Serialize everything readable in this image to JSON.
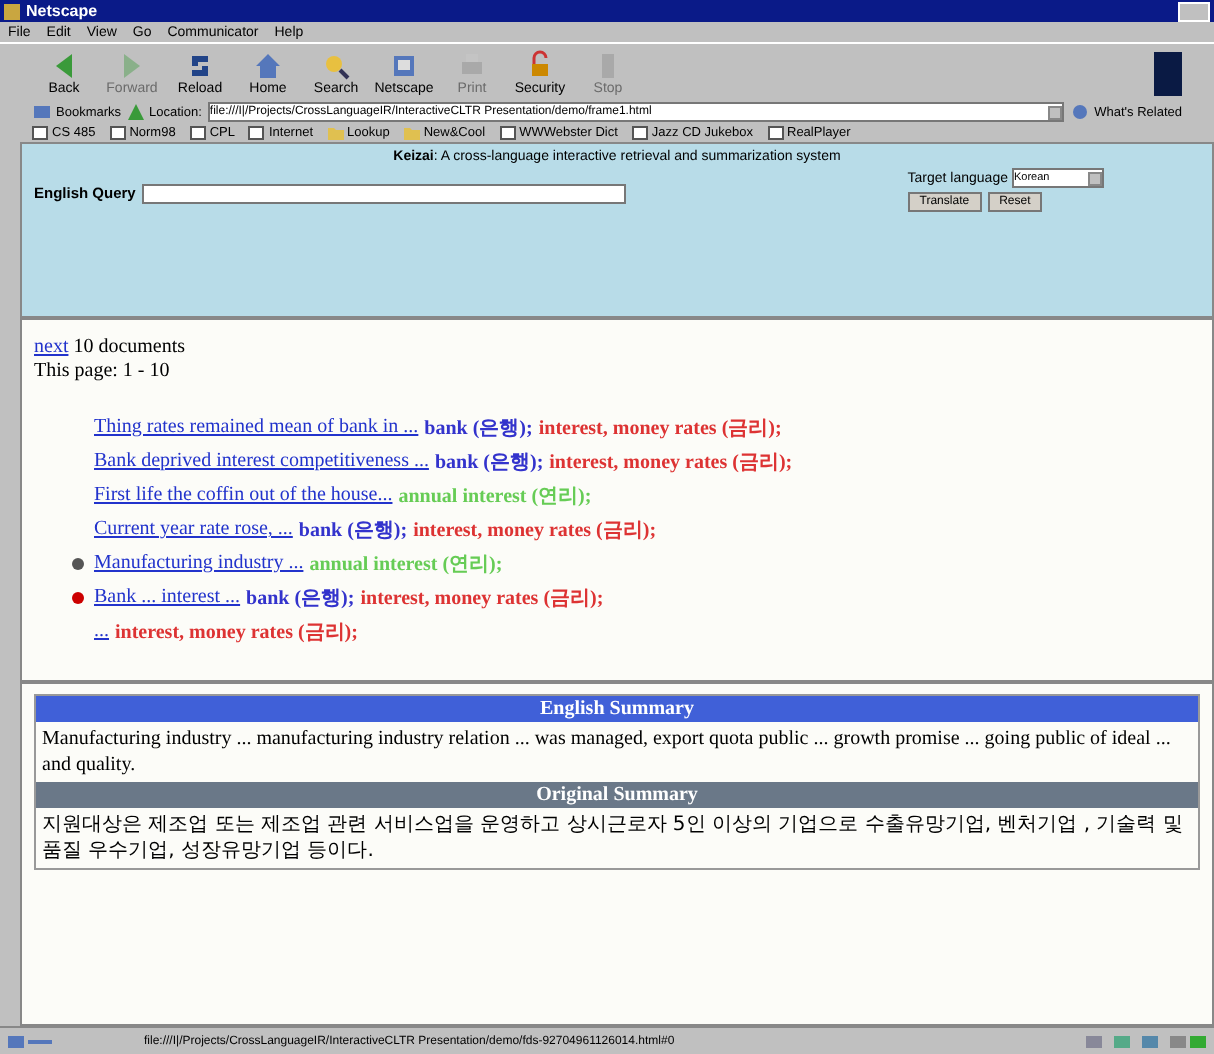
{
  "window": {
    "title": "Netscape"
  },
  "menu": [
    "File",
    "Edit",
    "View",
    "Go",
    "Communicator",
    "Help"
  ],
  "toolbar": [
    {
      "label": "Back",
      "disabled": false
    },
    {
      "label": "Forward",
      "disabled": true
    },
    {
      "label": "Reload",
      "disabled": false
    },
    {
      "label": "Home",
      "disabled": false
    },
    {
      "label": "Search",
      "disabled": false
    },
    {
      "label": "Netscape",
      "disabled": false
    },
    {
      "label": "Print",
      "disabled": true
    },
    {
      "label": "Security",
      "disabled": false
    },
    {
      "label": "Stop",
      "disabled": true
    }
  ],
  "location_bar": {
    "bookmarks": "Bookmarks",
    "label": "Location:",
    "url": "file:///I|/Projects/CrossLanguageIR/InteractiveCLTR Presentation/demo/frame1.html",
    "related": "What's Related"
  },
  "personal_toolbar": [
    {
      "label": "CS 485",
      "kind": "page"
    },
    {
      "label": "Norm98",
      "kind": "page"
    },
    {
      "label": "CPL",
      "kind": "page"
    },
    {
      "label": "Internet",
      "kind": "page"
    },
    {
      "label": "Lookup",
      "kind": "folder"
    },
    {
      "label": "New&Cool",
      "kind": "folder"
    },
    {
      "label": "WWWebster Dict",
      "kind": "page"
    },
    {
      "label": "Jazz CD Jukebox",
      "kind": "page"
    },
    {
      "label": "RealPlayer",
      "kind": "page"
    }
  ],
  "query_frame": {
    "brand": "Keizai",
    "tagline": ": A cross-language interactive retrieval and summarization system",
    "query_label": "English Query",
    "target_label": "Target language",
    "target_value": "Korean",
    "buttons": [
      "Translate",
      "Reset"
    ]
  },
  "results": {
    "next_link": "next",
    "next_text": "10 documents",
    "page_info": "This page: 1 - 10",
    "items": [
      {
        "title": "Thing rates remained mean of bank in ...",
        "terms": [
          {
            "text": "bank (은행);",
            "color": "#3333cc"
          },
          {
            "text": "interest, money rates (금리);",
            "color": "#dd3333"
          }
        ]
      },
      {
        "title": "Bank deprived interest competitiveness ...",
        "terms": [
          {
            "text": "bank (은행);",
            "color": "#3333cc"
          },
          {
            "text": "interest, money rates (금리);",
            "color": "#dd3333"
          }
        ]
      },
      {
        "title": "First life the coffin out of the house...",
        "terms": [
          {
            "text": "annual interest (연리);",
            "color": "#66cc55"
          }
        ]
      },
      {
        "title": "Current year rate rose, ...",
        "terms": [
          {
            "text": "bank (은행);",
            "color": "#3333cc"
          },
          {
            "text": "interest, money rates (금리);",
            "color": "#dd3333"
          }
        ]
      },
      {
        "title": "Manufacturing industry ...",
        "color": "#555555",
        "terms": [
          {
            "text": "annual interest (연리);",
            "color": "#66cc55"
          }
        ]
      },
      {
        "title": "Bank ... interest ...",
        "color": "#cc0000",
        "terms": [
          {
            "text": "bank (은행);",
            "color": "#3333cc"
          },
          {
            "text": "interest, money rates (금리);",
            "color": "#dd3333"
          }
        ]
      },
      {
        "title": "...",
        "terms": [
          {
            "text": "interest, money rates (금리);",
            "color": "#dd3333"
          }
        ]
      }
    ]
  },
  "summary": {
    "english_heading": "English Summary",
    "english_text": "Manufacturing industry ... manufacturing industry relation ... was managed, export quota public ... growth promise ... going public of ideal ... and quality.",
    "original_heading": "Original Summary",
    "original_text": "지원대상은 제조업 또는 제조업 관련 서비스업을 운영하고 상시근로자 5인 이상의 기업으로 수출유망기업, 벤처기업 , 기술력 및 품질 우수기업, 성장유망기업 등이다."
  },
  "status_bar": {
    "url": "file:///I|/Projects/CrossLanguageIR/InteractiveCLTR Presentation/demo/fds-92704961126014.html#0"
  }
}
